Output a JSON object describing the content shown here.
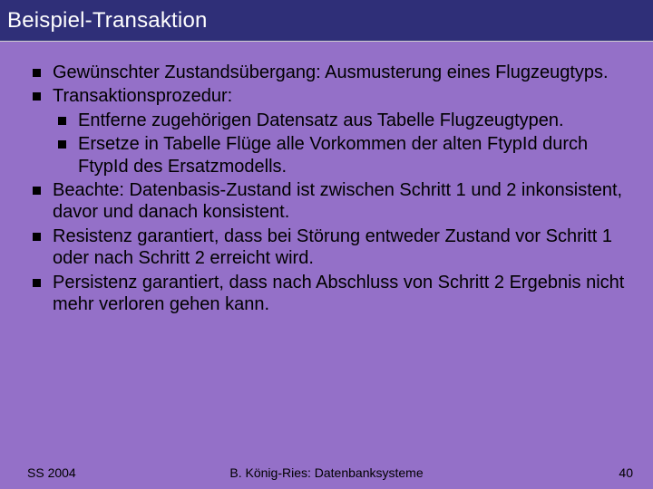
{
  "title": "Beispiel-Transaktion",
  "bullets": {
    "b0": "Gewünschter Zustandsübergang: Ausmusterung eines Flugzeugtyps.",
    "b1": "Transaktionsprozedur:",
    "b1_sub": {
      "s0": "Entferne zugehörigen Datensatz aus Tabelle Flugzeugtypen.",
      "s1": "Ersetze in Tabelle Flüge alle Vorkommen der alten FtypId durch FtypId des Ersatzmodells."
    },
    "b2": "Beachte: Datenbasis-Zustand ist zwischen Schritt 1 und 2 inkonsistent, davor und danach konsistent.",
    "b3": "Resistenz garantiert, dass bei Störung entweder Zustand vor Schritt 1 oder nach Schritt 2 erreicht wird.",
    "b4": "Persistenz garantiert, dass nach Abschluss von Schritt 2 Ergebnis nicht mehr verloren gehen kann."
  },
  "footer": {
    "left": "SS 2004",
    "center": "B. König-Ries: Datenbanksysteme",
    "right": "40"
  }
}
